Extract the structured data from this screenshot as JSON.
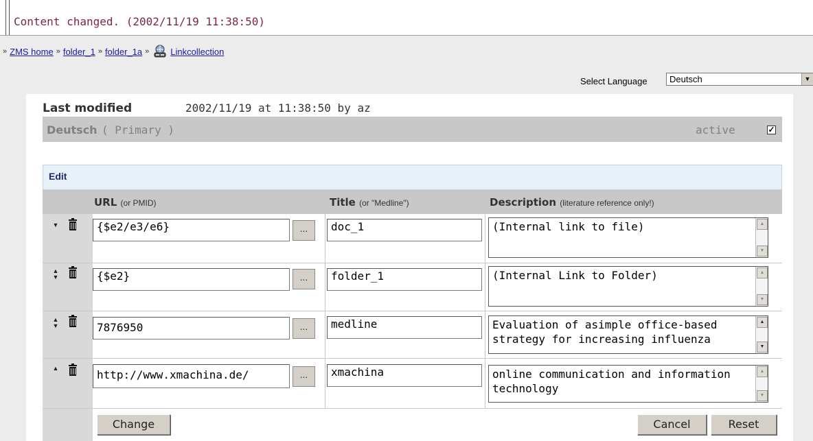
{
  "status": {
    "message": "Content changed. (2002/11/19 11:38:50)"
  },
  "breadcrumb": {
    "separator": "»",
    "items": [
      "ZMS home",
      "folder_1",
      "folder_1a",
      "Linkcollection"
    ]
  },
  "language_select": {
    "label": "Select Language",
    "value": "Deutsch"
  },
  "meta": {
    "last_modified_label": "Last modified",
    "last_modified_value": "2002/11/19 at 11:38:50 by az"
  },
  "language_bar": {
    "name": "Deutsch",
    "primary": "( Primary )",
    "active_label": "active",
    "active_checked": true,
    "check_mark": "✓"
  },
  "edit": {
    "title": "Edit",
    "columns": {
      "url": "URL",
      "url_hint": "(or PMID)",
      "title": "Title",
      "title_hint": "(or \"Medline\")",
      "description": "Description",
      "description_hint": "(literature reference only!)"
    },
    "browse_label": "...",
    "rows": [
      {
        "url": "{$e2/e3/e6}",
        "title": "doc_1",
        "description": "(Internal link to file)"
      },
      {
        "url": "{$e2}",
        "title": "folder_1",
        "description": "(Internal Link to Folder)"
      },
      {
        "url": "7876950",
        "title": "medline",
        "description": "Evaluation of asimple office-based strategy for increasing influenza"
      },
      {
        "url": "http://www.xmachina.de/",
        "title": "xmachina",
        "description": "online communication and information technology"
      }
    ],
    "buttons": {
      "change": "Change",
      "cancel": "Cancel",
      "reset": "Reset"
    }
  },
  "colors": {
    "status_text": "#7a2840",
    "link": "#1a1a9e",
    "edit_title": "#1a2a6e",
    "panel_bar": "#c8c8c8"
  }
}
